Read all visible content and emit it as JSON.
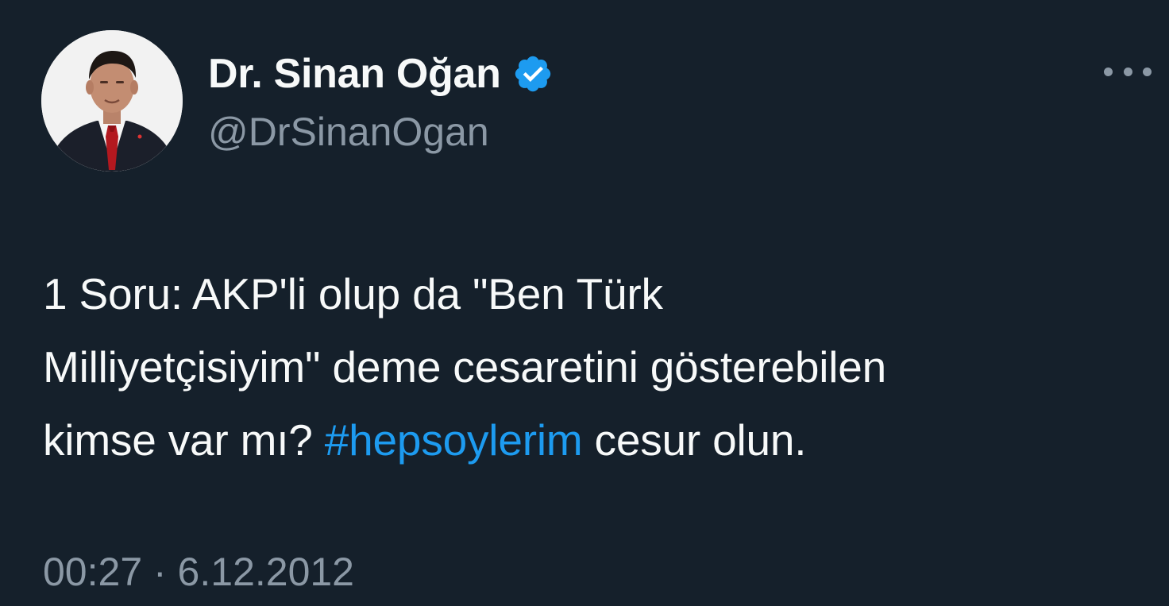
{
  "tweet": {
    "author": {
      "display_name": "Dr. Sinan Oğan",
      "handle": "@DrSinanOgan",
      "verified": true,
      "avatar_icon": "profile-photo"
    },
    "text": {
      "line1": "1 Soru: AKP'li olup da \"Ben Türk",
      "line2": "Milliyetçisiyim\" deme cesaretini gösterebilen",
      "line3_before": "kimse var mı? ",
      "hashtag": "#hepsoylerim",
      "line3_after": " cesur olun."
    },
    "timestamp": "00:27 · 6.12.2012",
    "more_icon": "more-horizontal-icon"
  },
  "colors": {
    "background": "#15202b",
    "text": "#f7f9f9",
    "secondary": "#8b98a5",
    "accent": "#1d9bf0"
  }
}
